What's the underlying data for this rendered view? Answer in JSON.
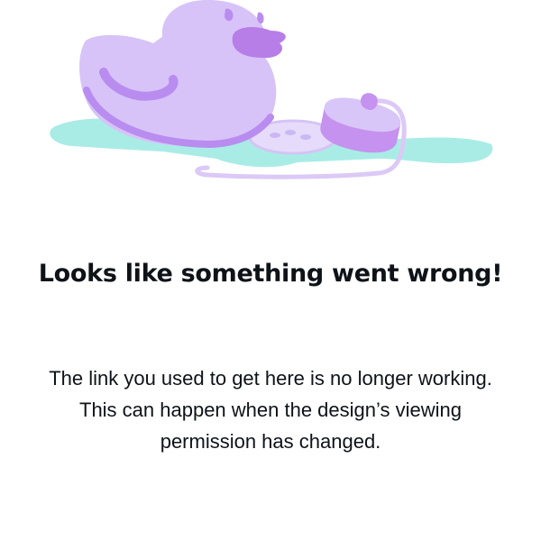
{
  "illustration": {
    "icon": "rubber-duck-with-drain-plug-icon",
    "colors": {
      "duck": "#d7c3f7",
      "duck_shade": "#b98cf0",
      "beak": "#b77ee8",
      "water": "#a9ece6",
      "plug": "#c592ef",
      "plug_top": "#d9c6f8"
    }
  },
  "error": {
    "title": "Looks like something went wrong!",
    "message_line1": "The link you used to get here is no longer working.",
    "message_line2": "This can happen when the design’s viewing permission has changed."
  },
  "colors": {
    "text": "#0e1318",
    "background": "#ffffff"
  }
}
